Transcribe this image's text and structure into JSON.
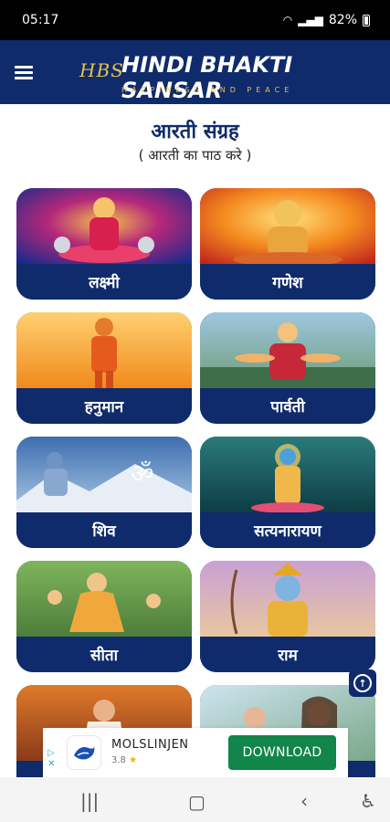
{
  "status_bar": {
    "time": "05:17",
    "battery": "82%"
  },
  "header": {
    "logo_abbr": "HBS",
    "title": "HINDI BHAKTI SANSAR",
    "tagline": "HAPPINESS AND PEACE"
  },
  "page": {
    "title": "आरती संग्रह",
    "subtitle": "( आरती का पाठ करे )"
  },
  "cards": [
    {
      "label": "लक्ष्मी"
    },
    {
      "label": "गणेश"
    },
    {
      "label": "हनुमान"
    },
    {
      "label": "पार्वती"
    },
    {
      "label": "शिव"
    },
    {
      "label": "सत्यनारायण"
    },
    {
      "label": "सीता"
    },
    {
      "label": "राम"
    },
    {
      "label": ""
    },
    {
      "label": ""
    }
  ],
  "ad": {
    "marker": "▷\n✕",
    "app_name": "MOLSLINJEN",
    "rating": "3.8",
    "cta": "DOWNLOAD"
  },
  "colors": {
    "primary": "#0f2b6b",
    "accent": "#e8c24a",
    "download": "#12854a"
  }
}
